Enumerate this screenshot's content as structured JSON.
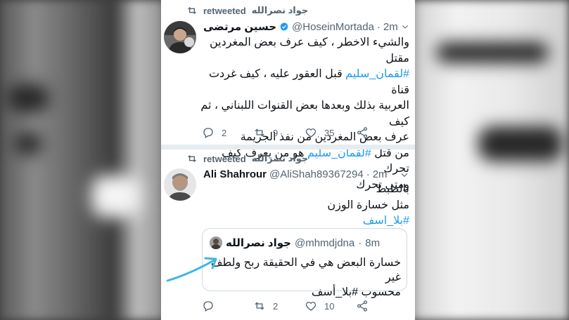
{
  "tweets": [
    {
      "retweeted_by": "جواد نصرالله",
      "retweeted_label": "retweeted",
      "name": "حسين مرتضى",
      "handle": "@HoseinMortada",
      "sep": "·",
      "time": "2m",
      "body_lines": [
        "والشيء الاخطر ، كيف عرف بعض المغردين مقتل",
        "#لقمان_سليم قبل العقور عليه ، كيف غردت قناة",
        "العربية بذلك وبعدها بعض القنوات اللبناني ، ثم كيف",
        "عرف بعض المغردين من نفذ الجريمة",
        "من قتل #لقمان_سليم هو من يعرف كيف تحرك",
        "ومتى تحرك"
      ],
      "replies": "2",
      "retweets": "9",
      "likes": "35"
    },
    {
      "retweeted_by": "جواد نصرالله",
      "retweeted_label": "retweeted",
      "name": "Ali Shahrour",
      "handle": "@AliShah89367294",
      "sep": "·",
      "time": "2m",
      "body_lines": [
        "بالظبط",
        "مثل خسارة الوزن",
        "#بلا_اسف"
      ],
      "quote": {
        "name": "جواد نصرالله",
        "handle": "@mhmdjdna",
        "sep": "·",
        "time": "8m",
        "body_lines": [
          "خسارة البعض هي في الحقيقة ربح ولطف غير",
          "محسوب #بلا_أسف"
        ]
      },
      "replies": "",
      "retweets": "2",
      "likes": "10"
    }
  ],
  "colors": {
    "hashtag": "#1d9bf0",
    "verified": "#1d9bf0",
    "annotation_arrow": "#3fb6e6"
  }
}
